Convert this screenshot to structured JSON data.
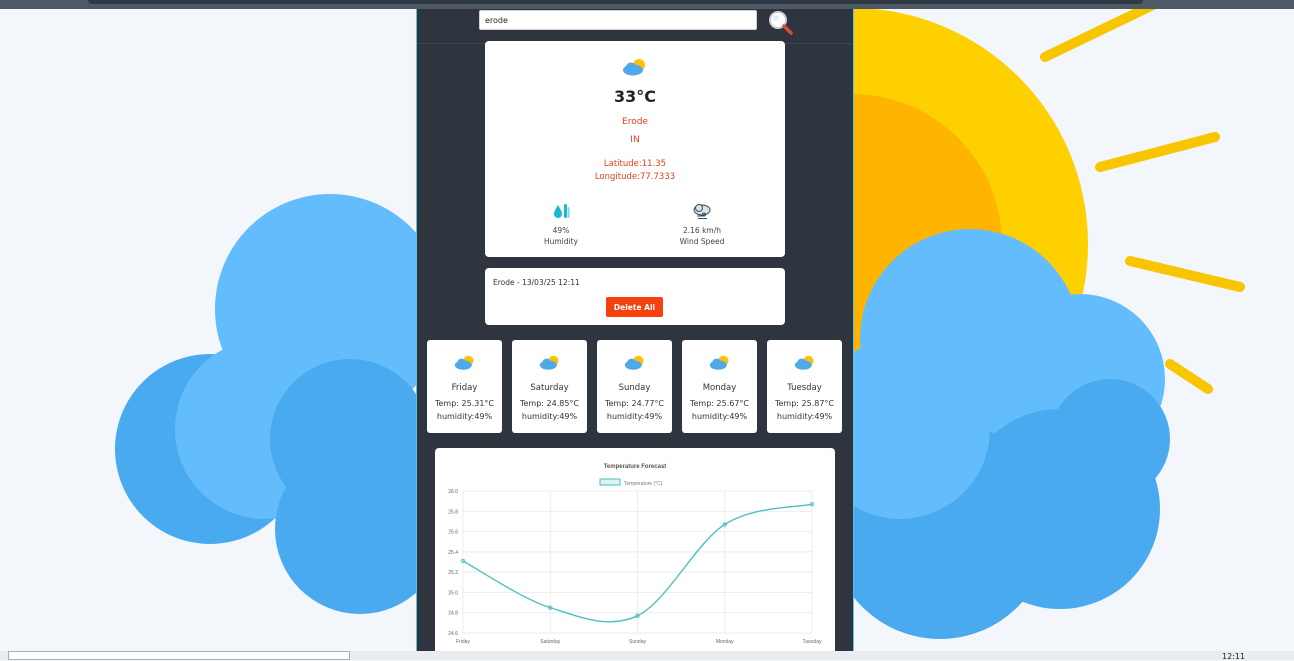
{
  "search": {
    "value": "erode"
  },
  "current": {
    "icon": "partly-cloudy-icon",
    "temperature": "33°C",
    "city": "Erode",
    "country": "IN",
    "latitude": "Latitude:11.35",
    "longitude": "Longitude:77.7333",
    "humidity": {
      "value": "49%",
      "label": "Humidity",
      "icon": "humidity-drop-icon"
    },
    "wind": {
      "value": "2.16 km/h",
      "label": "Wind Speed",
      "icon": "wind-cloud-icon"
    }
  },
  "history": {
    "entries": [
      "Erode - 13/03/25 12:11"
    ],
    "delete_label": "Delete All"
  },
  "forecast": [
    {
      "day": "Friday",
      "temp": "Temp: 25.31°C",
      "humidity": "humidity:49%"
    },
    {
      "day": "Saturday",
      "temp": "Temp: 24.85°C",
      "humidity": "humidity:49%"
    },
    {
      "day": "Sunday",
      "temp": "Temp: 24.77°C",
      "humidity": "humidity:49%"
    },
    {
      "day": "Monday",
      "temp": "Temp: 25.67°C",
      "humidity": "humidity:49%"
    },
    {
      "day": "Tuesday",
      "temp": "Temp: 25.87°C",
      "humidity": "humidity:49%"
    }
  ],
  "taskbar": {
    "clock": "12:11"
  },
  "colors": {
    "panel": "#2e353e",
    "accent": "#f5410e",
    "line": "#4bc0c0"
  },
  "chart_data": {
    "type": "line",
    "title": "Temperature Forecast",
    "categories": [
      "Friday",
      "Saturday",
      "Sunday",
      "Monday",
      "Tuesday"
    ],
    "series": [
      {
        "name": "Temperature (°C)",
        "values": [
          25.31,
          24.85,
          24.77,
          25.67,
          25.87
        ]
      }
    ],
    "ylim": [
      24.6,
      26.0
    ],
    "yticks": [
      "24.6",
      "24.8",
      "25.0",
      "25.2",
      "25.4",
      "25.6",
      "25.8",
      "26.0"
    ],
    "grid": true,
    "legend": "top"
  }
}
